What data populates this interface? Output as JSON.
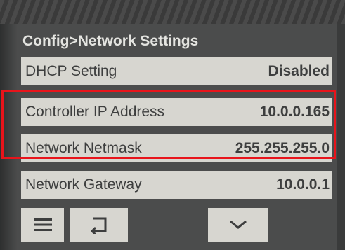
{
  "screen": {
    "title": "Config>Network Settings",
    "rows": [
      {
        "label": "DHCP Setting",
        "value": "Disabled"
      },
      {
        "label": "Controller IP Address",
        "value": "10.0.0.165"
      },
      {
        "label": "Network Netmask",
        "value": "255.255.255.0"
      },
      {
        "label": "Network Gateway",
        "value": "10.0.0.1"
      }
    ],
    "buttons": [
      {
        "icon": "menu-icon"
      },
      {
        "icon": "back-arrow-icon"
      },
      {
        "icon": "chevron-down-icon"
      }
    ]
  },
  "colors": {
    "screen_bg": "#4b4c4c",
    "row_bg": "#d7d6d0",
    "text": "#3d3e3e",
    "title_text": "#e4e4e0",
    "highlight": "#e8141b"
  }
}
